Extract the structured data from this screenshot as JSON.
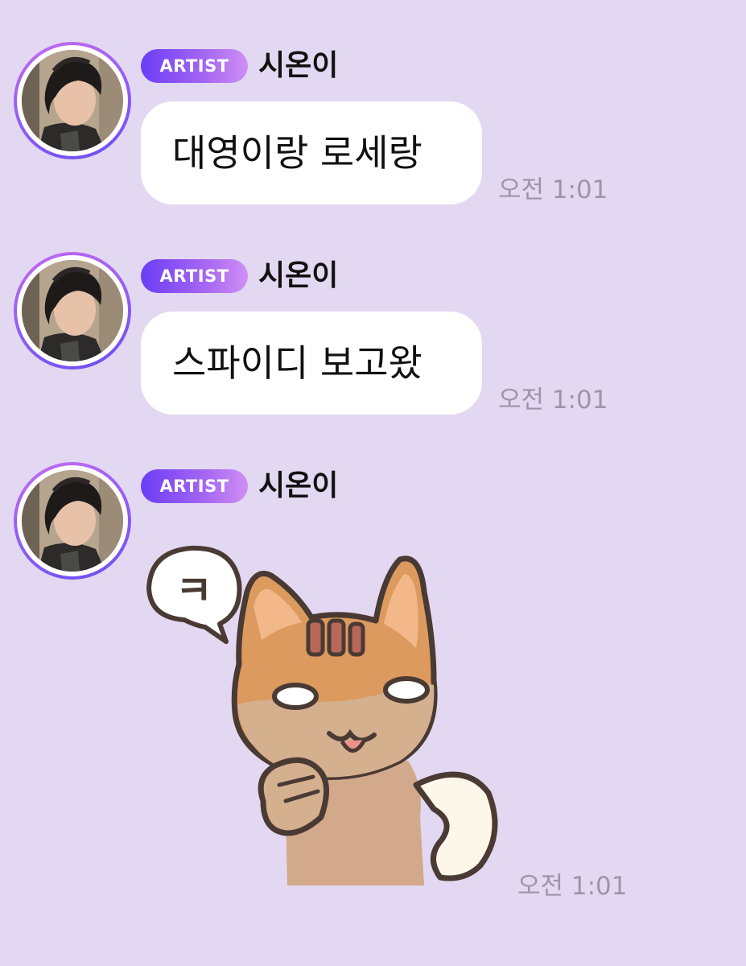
{
  "messages": [
    {
      "badge": "ARTIST",
      "sender": "시온이",
      "text": "대영이랑 로세랑",
      "time": "오전 1:01"
    },
    {
      "badge": "ARTIST",
      "sender": "시온이",
      "text": "스파이디 보고왔",
      "time": "오전 1:01"
    },
    {
      "badge": "ARTIST",
      "sender": "시온이",
      "sticker": {
        "icon": "laughing-fox-cat-sticker",
        "bubble_text": "ㅋ"
      },
      "time": "오전 1:01"
    }
  ],
  "colors": {
    "background": "#e3d8f1",
    "bubble": "#ffffff",
    "badge_start": "#6b3df5",
    "badge_end": "#d08ff5",
    "avatar_ring": "#a566f2",
    "time_text": "#9c95a6"
  }
}
